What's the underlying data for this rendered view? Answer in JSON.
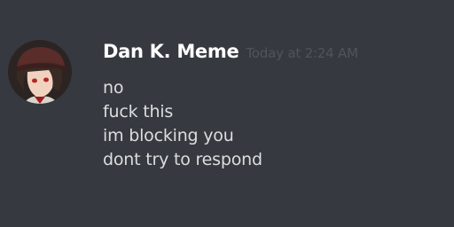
{
  "message": {
    "author": "Dan K. Meme",
    "timestamp": "Today at 2:24 AM",
    "lines": [
      "no",
      "fuck this",
      "im blocking you",
      "dont try to respond"
    ]
  },
  "avatar": {
    "icon": "user-avatar-anime-character-red-hat"
  },
  "colors": {
    "background": "#36393f",
    "username": "#ffffff",
    "timestamp": "#4f545c",
    "message_text": "#dcddde"
  }
}
